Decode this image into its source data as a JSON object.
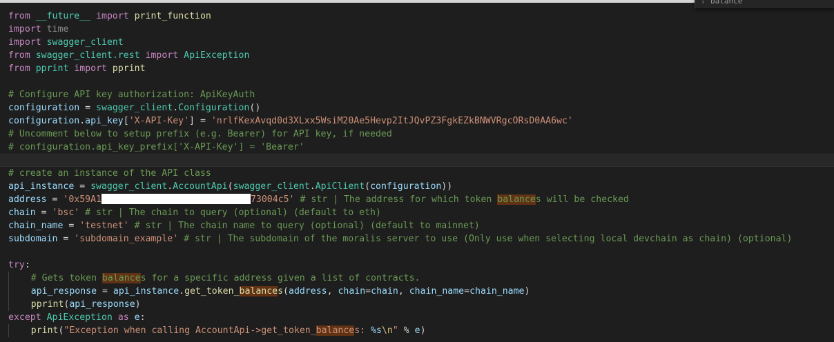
{
  "find_widget": {
    "chevron": "›",
    "value": "balance"
  },
  "code": {
    "l1": {
      "from": "from",
      "module": "__future__",
      "import": "import",
      "name": "print_function"
    },
    "l2": {
      "import": "import",
      "module": "time"
    },
    "l3": {
      "import": "import",
      "module": "swagger_client"
    },
    "l4": {
      "from": "from",
      "module": "swagger_client.rest",
      "import": "import",
      "name": "ApiException"
    },
    "l5": {
      "from": "from",
      "module": "pprint",
      "import": "import",
      "name": "pprint"
    },
    "l7": {
      "comment": "# Configure API key authorization: ApiKeyAuth"
    },
    "l8": {
      "var": "configuration",
      "eq": " = ",
      "obj": "swagger_client",
      "dot": ".",
      "fn": "Configuration",
      "paren": "()"
    },
    "l9": {
      "var": "configuration",
      "dot": ".",
      "attr": "api_key",
      "lb": "[",
      "key": "'X-API-Key'",
      "rb": "]",
      "eq": " = ",
      "val": "'nrlfKexAvqd0d3XLxx5WsiM20Ae5Hevp2ItJQvPZ3FgkEZkBNWVRgcORsD0AA6wc'"
    },
    "l10": {
      "comment": "# Uncomment below to setup prefix (e.g. Bearer) for API key, if needed"
    },
    "l11": {
      "comment": "# configuration.api_key_prefix['X-API-Key'] = 'Bearer'"
    },
    "l13": {
      "comment": "# create an instance of the API class"
    },
    "l14": {
      "var": "api_instance",
      "eq": " = ",
      "obj1": "swagger_client",
      "dot1": ".",
      "fn1": "AccountApi",
      "p1": "(",
      "obj2": "swagger_client",
      "dot2": ".",
      "fn2": "ApiClient",
      "p2": "(",
      "arg": "configuration",
      "p3": "))"
    },
    "l15": {
      "var": "address",
      "eq": " = ",
      "str_a": "'0x59A1",
      "str_b": "73004c5'",
      "com_a": " # str | The address for which token ",
      "com_hl": "balance",
      "com_b": "s will be checked"
    },
    "l16": {
      "var": "chain",
      "eq": " = ",
      "str": "'bsc'",
      "com": " # str | The chain to query (optional) (default to eth)"
    },
    "l17": {
      "var": "chain_name",
      "eq": " = ",
      "str": "'testnet'",
      "com": " # str | The chain name to query (optional) (default to mainnet)"
    },
    "l18": {
      "var": "subdomain",
      "eq": " = ",
      "str": "'subdomain_example'",
      "com": " # str | The subdomain of the moralis server to use (Only use when selecting local devchain as chain) (optional)"
    },
    "l20": {
      "kw": "try",
      "colon": ":"
    },
    "l21": {
      "com_a": "# Gets token ",
      "com_hl": "balance",
      "com_b": "s for a specific address given a list of contracts."
    },
    "l22": {
      "var": "api_response",
      "eq": " = ",
      "obj": "api_instance",
      "dot": ".",
      "fn_a": "get_token_",
      "fn_hl": "balance",
      "fn_b": "s",
      "p1": "(",
      "a1": "address",
      "c1": ", ",
      "a2": "chain",
      "e2": "=",
      "v2": "chain",
      "c2": ", ",
      "a3": "chain_name",
      "e3": "=",
      "v3": "chain_name",
      "p2": ")"
    },
    "l23": {
      "fn": "pprint",
      "p1": "(",
      "arg": "api_response",
      "p2": ")"
    },
    "l24": {
      "kw": "except",
      "cls": "ApiException",
      "as": "as",
      "var": "e",
      "colon": ":"
    },
    "l25": {
      "fn": "print",
      "p1": "(",
      "str_a": "\"Exception when calling AccountApi->get_token_",
      "str_hl": "balance",
      "str_b": "s: ",
      "esc1": "%s",
      "esc2": "\\n",
      "str_c": "\"",
      "pct": " % ",
      "var": "e",
      "p2": ")"
    }
  },
  "colors": {
    "background": "#1e1e1e",
    "keyword": "#c586c0",
    "module": "#4ec9b0",
    "variable": "#9cdcfe",
    "function": "#dcdcaa",
    "string": "#ce9178",
    "comment": "#6a9955",
    "match_highlight": "#613214"
  }
}
